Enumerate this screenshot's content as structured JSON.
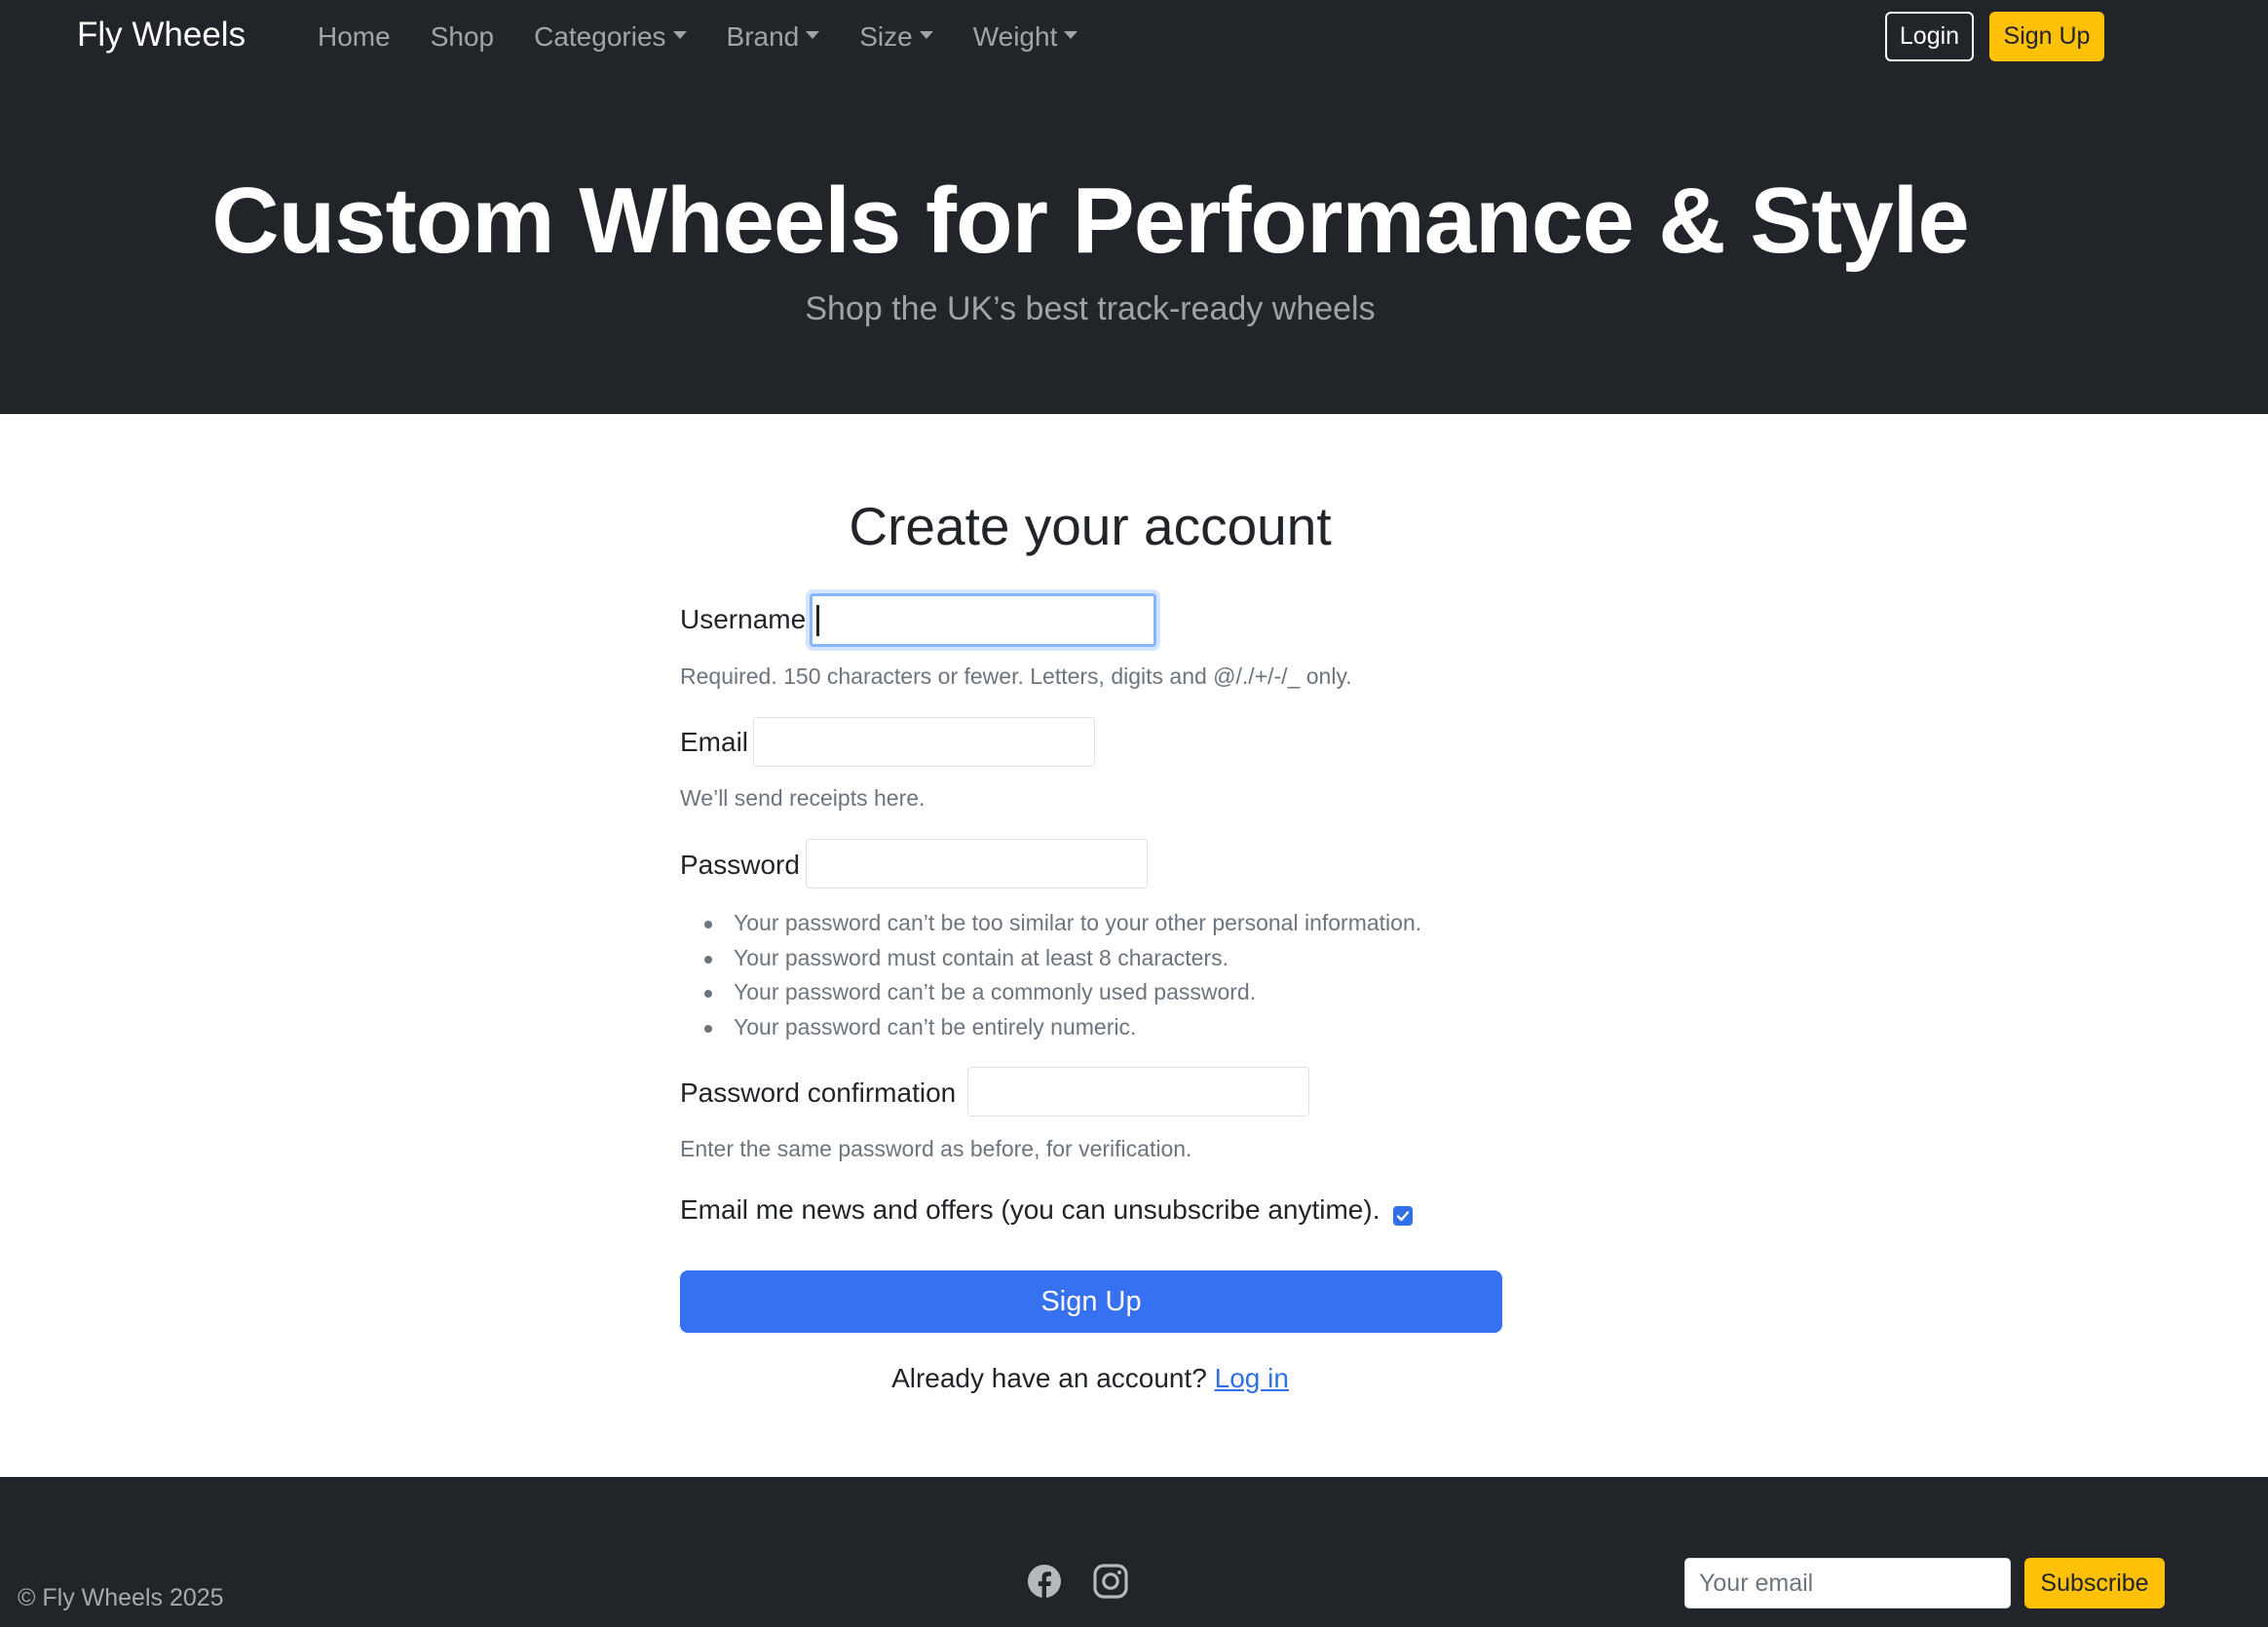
{
  "nav": {
    "brand": "Fly Wheels",
    "links": [
      {
        "label": "Home",
        "dropdown": false
      },
      {
        "label": "Shop",
        "dropdown": false
      },
      {
        "label": "Categories",
        "dropdown": true
      },
      {
        "label": "Brand",
        "dropdown": true
      },
      {
        "label": "Size",
        "dropdown": true
      },
      {
        "label": "Weight",
        "dropdown": true
      }
    ],
    "login_label": "Login",
    "signup_label": "Sign Up"
  },
  "hero": {
    "title": "Custom Wheels for Performance & Style",
    "subtitle": "Shop the UK’s best track-ready wheels"
  },
  "form": {
    "title": "Create your account",
    "username": {
      "label": "Username",
      "value": "",
      "help": "Required. 150 characters or fewer. Letters, digits and @/./+/-/_ only."
    },
    "email": {
      "label": "Email",
      "value": "",
      "help": "We’ll send receipts here."
    },
    "password": {
      "label": "Password",
      "value": "",
      "help_items": [
        "Your password can’t be too similar to your other personal information.",
        "Your password must contain at least 8 characters.",
        "Your password can’t be a commonly used password.",
        "Your password can’t be entirely numeric."
      ]
    },
    "password_confirmation": {
      "label": "Password confirmation",
      "value": "",
      "help": "Enter the same password as before, for verification."
    },
    "newsletter": {
      "label": "Email me news and offers (you can unsubscribe anytime).",
      "checked": true
    },
    "submit_label": "Sign Up",
    "already_text": "Already have an account?",
    "login_link": "Log in"
  },
  "footer": {
    "copyright": "© Fly Wheels 2025",
    "social_icons": [
      "facebook-icon",
      "instagram-icon"
    ],
    "email_placeholder": "Your email",
    "subscribe_label": "Subscribe"
  },
  "colors": {
    "dark": "#212529",
    "accent_yellow": "#ffc107",
    "primary_blue": "#3571f0",
    "muted": "#6c757d"
  }
}
